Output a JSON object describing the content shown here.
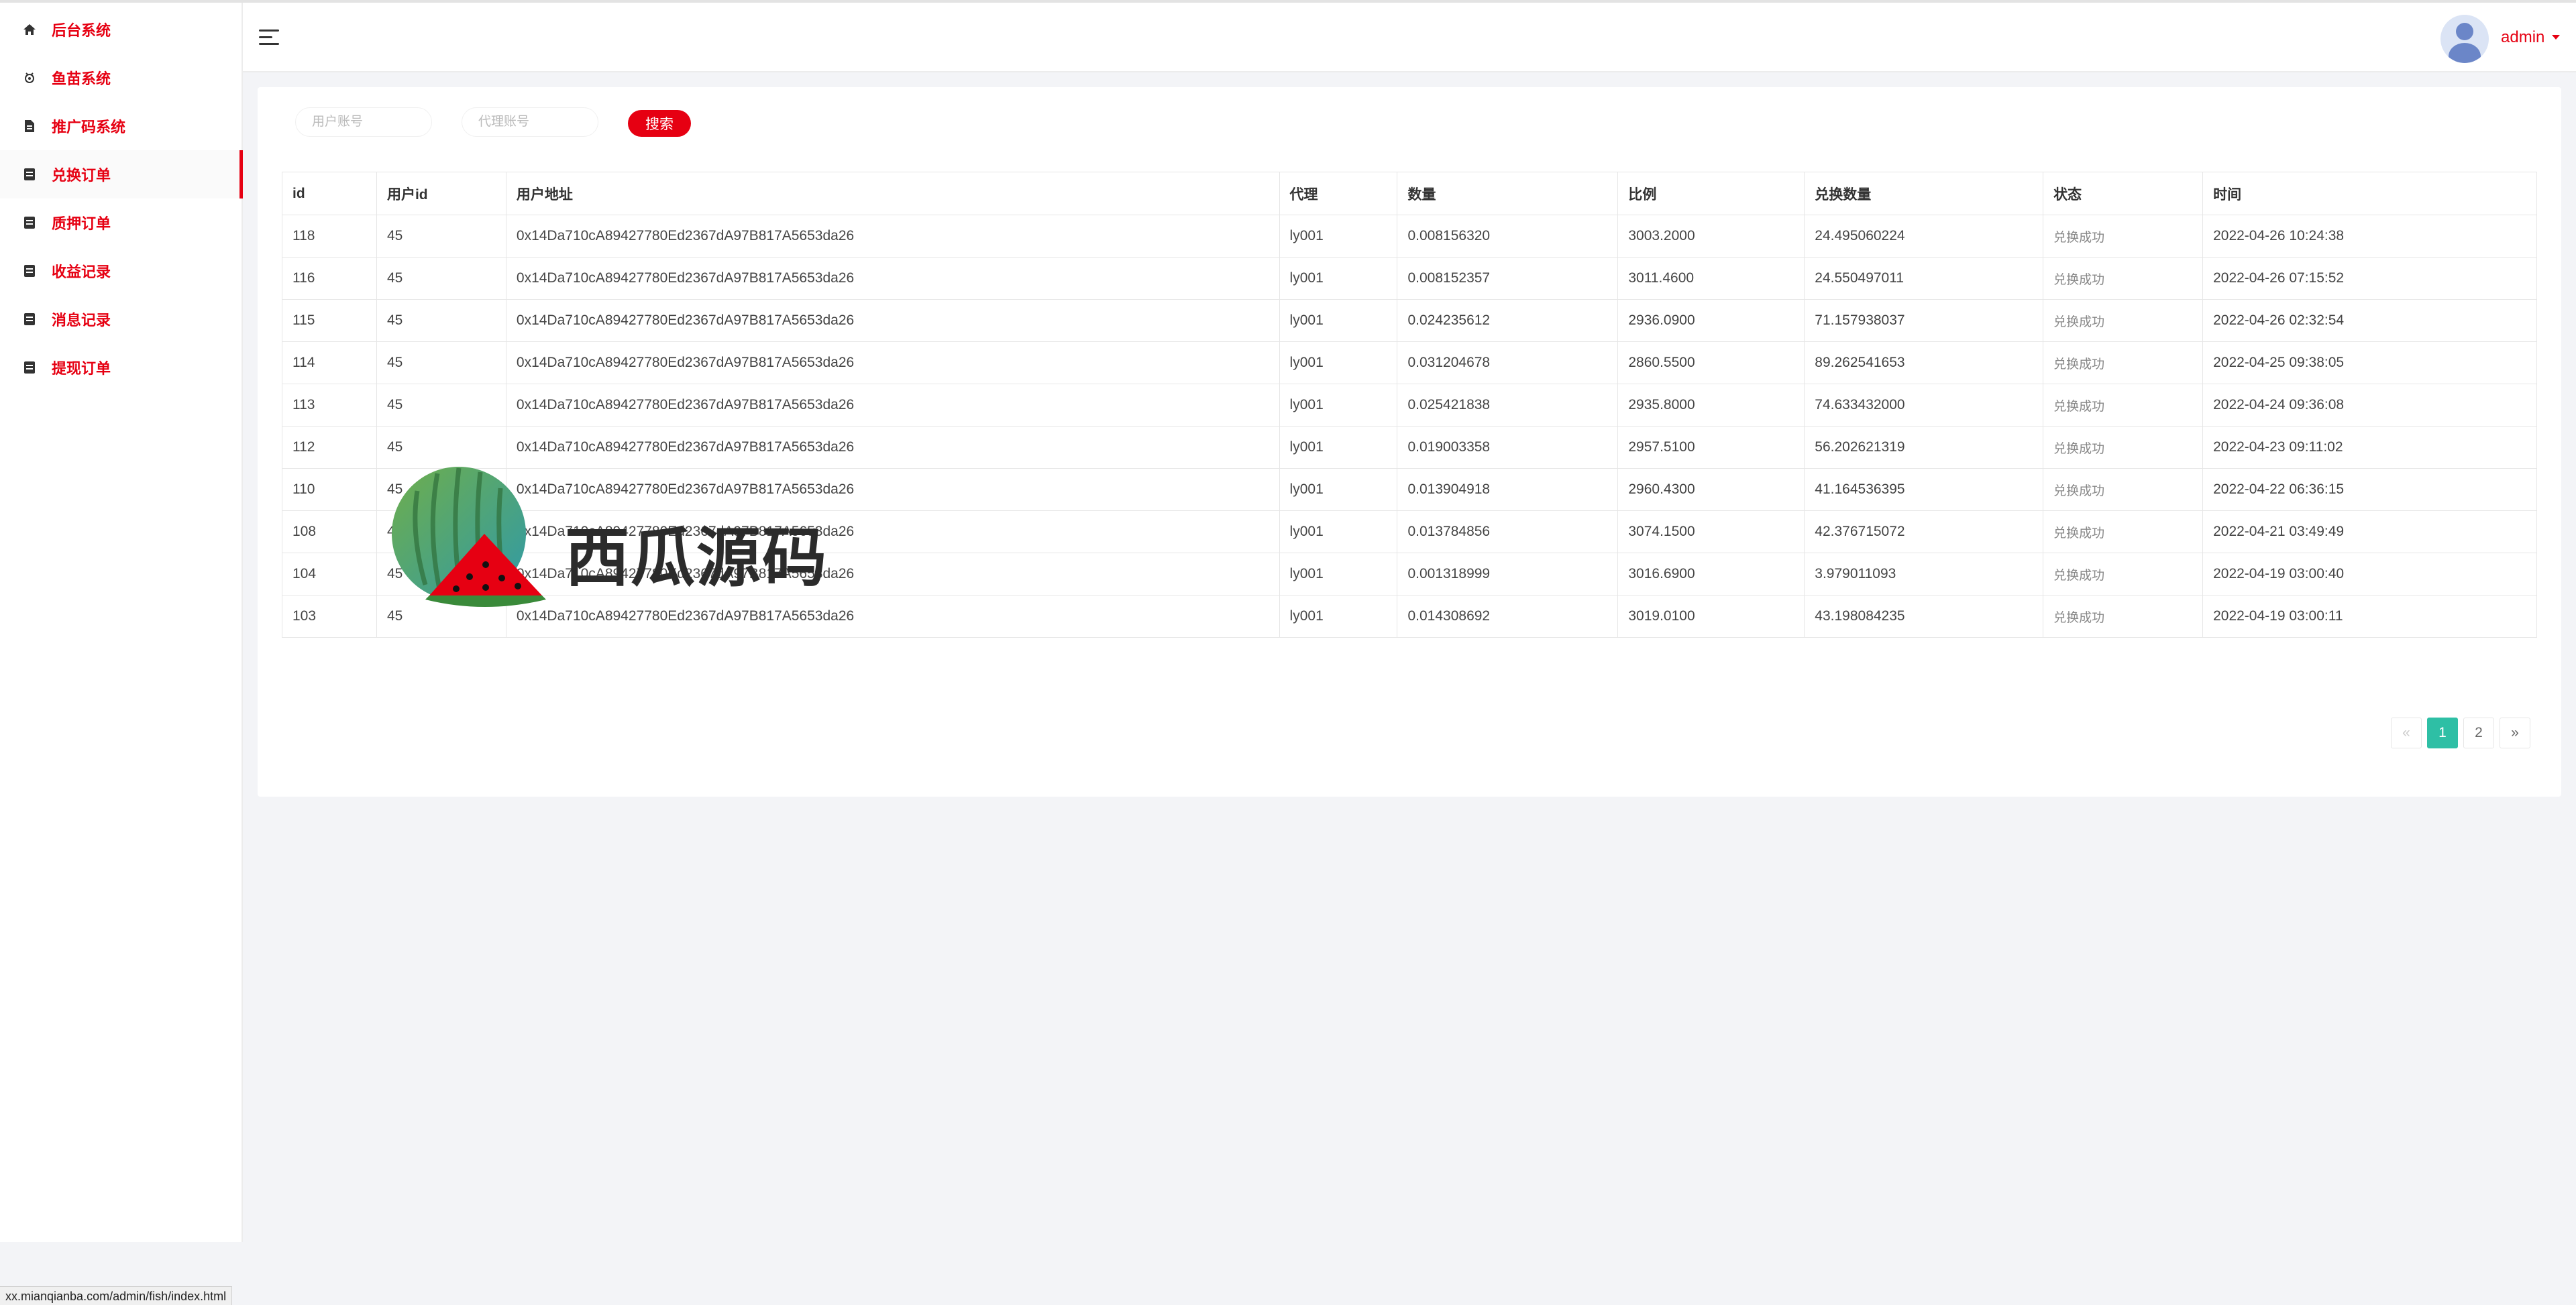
{
  "sidebar": {
    "items": [
      {
        "label": "后台系统",
        "icon": "home-icon"
      },
      {
        "label": "鱼苗系统",
        "icon": "fish-icon"
      },
      {
        "label": "推广码系统",
        "icon": "document-icon"
      },
      {
        "label": "兑换订单",
        "icon": "list-icon",
        "active": true
      },
      {
        "label": "质押订单",
        "icon": "list-icon"
      },
      {
        "label": "收益记录",
        "icon": "list-icon"
      },
      {
        "label": "消息记录",
        "icon": "list-icon"
      },
      {
        "label": "提现订单",
        "icon": "list-icon"
      }
    ]
  },
  "header": {
    "menu_icon": "hamburger-icon",
    "user": {
      "name": "admin",
      "avatar": "user-avatar-icon"
    }
  },
  "filters": {
    "user_account_placeholder": "用户账号",
    "agent_account_placeholder": "代理账号",
    "search_label": "搜索"
  },
  "table": {
    "columns": [
      "id",
      "用户id",
      "用户地址",
      "代理",
      "数量",
      "比例",
      "兑换数量",
      "状态",
      "时间"
    ],
    "rows": [
      [
        "118",
        "45",
        "0x14Da710cA89427780Ed2367dA97B817A5653da26",
        "ly001",
        "0.008156320",
        "3003.2000",
        "24.495060224",
        "兑换成功",
        "2022-04-26 10:24:38"
      ],
      [
        "116",
        "45",
        "0x14Da710cA89427780Ed2367dA97B817A5653da26",
        "ly001",
        "0.008152357",
        "3011.4600",
        "24.550497011",
        "兑换成功",
        "2022-04-26 07:15:52"
      ],
      [
        "115",
        "45",
        "0x14Da710cA89427780Ed2367dA97B817A5653da26",
        "ly001",
        "0.024235612",
        "2936.0900",
        "71.157938037",
        "兑换成功",
        "2022-04-26 02:32:54"
      ],
      [
        "114",
        "45",
        "0x14Da710cA89427780Ed2367dA97B817A5653da26",
        "ly001",
        "0.031204678",
        "2860.5500",
        "89.262541653",
        "兑换成功",
        "2022-04-25 09:38:05"
      ],
      [
        "113",
        "45",
        "0x14Da710cA89427780Ed2367dA97B817A5653da26",
        "ly001",
        "0.025421838",
        "2935.8000",
        "74.633432000",
        "兑换成功",
        "2022-04-24 09:36:08"
      ],
      [
        "112",
        "45",
        "0x14Da710cA89427780Ed2367dA97B817A5653da26",
        "ly001",
        "0.019003358",
        "2957.5100",
        "56.202621319",
        "兑换成功",
        "2022-04-23 09:11:02"
      ],
      [
        "110",
        "45",
        "0x14Da710cA89427780Ed2367dA97B817A5653da26",
        "ly001",
        "0.013904918",
        "2960.4300",
        "41.164536395",
        "兑换成功",
        "2022-04-22 06:36:15"
      ],
      [
        "108",
        "45",
        "0x14Da710cA89427780Ed2367dA97B817A5653da26",
        "ly001",
        "0.013784856",
        "3074.1500",
        "42.376715072",
        "兑换成功",
        "2022-04-21 03:49:49"
      ],
      [
        "104",
        "45",
        "0x14Da710cA89427780Ed2367dA97B817A5653da26",
        "ly001",
        "0.001318999",
        "3016.6900",
        "3.979011093",
        "兑换成功",
        "2022-04-19 03:00:40"
      ],
      [
        "103",
        "45",
        "0x14Da710cA89427780Ed2367dA97B817A5653da26",
        "ly001",
        "0.014308692",
        "3019.0100",
        "43.198084235",
        "兑换成功",
        "2022-04-19 03:00:11"
      ]
    ]
  },
  "pagination": {
    "prev": "«",
    "pages": [
      "1",
      "2"
    ],
    "current": "1",
    "next": "»"
  },
  "watermark": {
    "text": "西瓜源码",
    "icon": "watermelon-logo-icon"
  },
  "status_bar": {
    "url": "xx.mianqianba.com/admin/fish/index.html"
  },
  "colors": {
    "accent": "#e60012",
    "pagination_active": "#2ebfa5",
    "background": "#f3f4f7"
  }
}
